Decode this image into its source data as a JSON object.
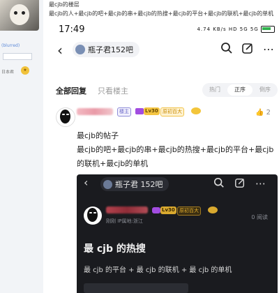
{
  "forum_page": {
    "thread_title": "最cjb的楼层",
    "thread_subtitle": "最cjb的人+最cjb的吧+最cjb的串+最cjb的热搜+最cjb的平台+最cjb的联机+最cjb的单机",
    "side_tag": "(blurred)",
    "side_text": "日本君"
  },
  "status_bar": {
    "time": "17:49",
    "icons": "4.74 KB/s  HD  5G  5G",
    "battery_color": "#2fb24c"
  },
  "nav": {
    "back_icon": "chevron-left-icon",
    "forum_name": "瓶子君152吧",
    "search_icon": "search-icon",
    "edit_icon": "edit-icon",
    "more_icon": "more-icon"
  },
  "tabs": {
    "all_replies": "全部回复",
    "owner_only": "只看楼主",
    "sort_options": [
      "热门",
      "正序",
      "倒序"
    ],
    "sort_selected": "正序"
  },
  "reply": {
    "owner_badge": "楼主",
    "level": "Lv30",
    "rank": "原初百大",
    "like_count": "2",
    "line1": "最cjb的帖子",
    "line2": "最cjb的吧+最cjb的串+最cjb的热搜+最cjb的平台+最cjb",
    "line3": "的联机+最cjb的单机"
  },
  "embedded": {
    "forum_name": "瓶子君 152吧",
    "level": "Lv30",
    "rank": "原初百大",
    "meta": "刚刚  IP属地:浙江",
    "read": "0 阅读",
    "title": "最 cjb 的热搜",
    "body": "最 cjb 的平台 + 最 cjb 的联机 + 最 cjb 的单机",
    "next_title": "最cjb的热搜"
  },
  "colors": {
    "accent": "#6c69c8",
    "dark_bg": "#1a1b1f",
    "level_gold": "#f4c542"
  }
}
